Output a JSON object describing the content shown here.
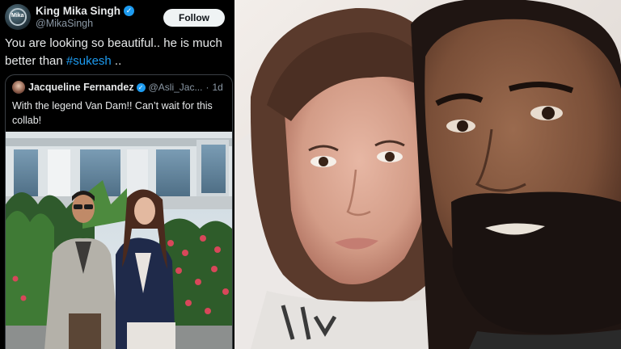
{
  "tweet": {
    "display_name": "King Mika Singh",
    "handle": "@MikaSingh",
    "follow_label": "Follow",
    "avatar_text": "Mika",
    "body_text": "You are looking so beautiful.. he is much better than ",
    "hashtag": "#sukesh",
    "body_suffix": " ..",
    "quote": {
      "display_name": "Jacqueline Fernandez",
      "handle": "@Asli_Jac...",
      "separator": "·",
      "time": "1d",
      "text": "With the legend Van Dam!! Can’t wait for this collab!"
    }
  },
  "colors": {
    "background": "#000000",
    "text": "#e7e9ea",
    "secondary": "#8b98a5",
    "accent": "#1d9bf0",
    "follow_bg": "#eff3f4"
  },
  "icons": {
    "verified": "verified-badge-icon"
  }
}
